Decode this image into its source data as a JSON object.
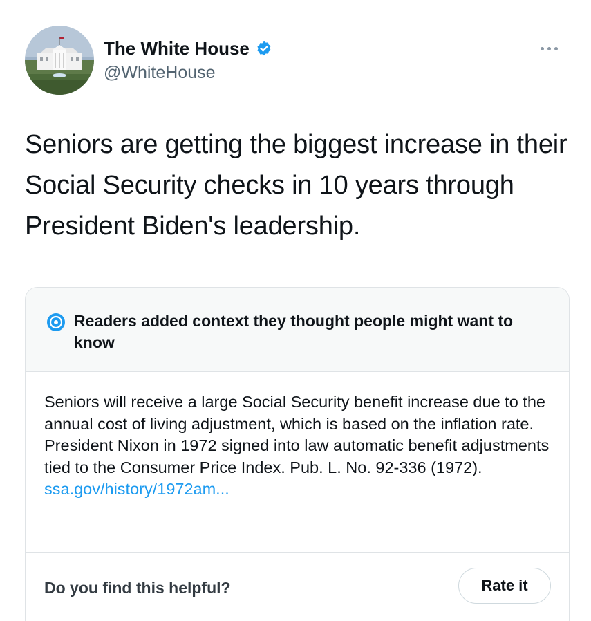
{
  "header": {
    "display_name": "The White House",
    "handle": "@WhiteHouse",
    "verified_icon": "verified-badge-icon",
    "avatar_icon": "white-house-avatar",
    "more_icon": "more-options-icon"
  },
  "tweet": {
    "text": "Seniors are getting the biggest increase in their Social Security checks in 10 years through President Biden's leadership."
  },
  "note": {
    "icon": "community-notes-icon",
    "title": "Readers added context they thought people might want to know",
    "body": "Seniors will receive a large Social Security benefit increase due to the annual cost of living adjustment, which is based on the inflation rate. President Nixon in 1972 signed into law automatic benefit adjustments tied to the Consumer Price Index. Pub. L. No. 92-336 (1972).",
    "link": "ssa.gov/history/1972am...",
    "helpful_question": "Do you find this helpful?",
    "rate_label": "Rate it"
  },
  "colors": {
    "accent": "#1d9bf0",
    "text": "#0f1419",
    "secondary": "#536471",
    "card_header_bg": "#f7f9f9",
    "border": "#dfe3e6"
  }
}
